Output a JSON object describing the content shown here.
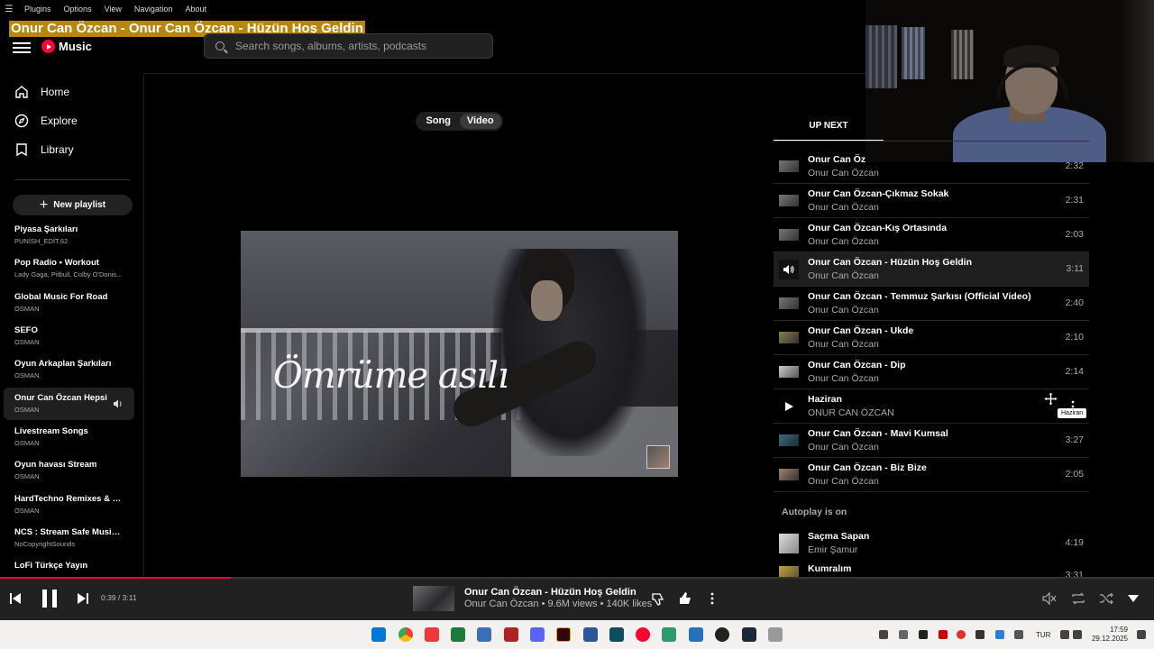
{
  "menu": {
    "items": [
      "Plugins",
      "Options",
      "View",
      "Navigation",
      "About"
    ]
  },
  "window_title": "Onur Can Özcan - Onur Can Özcan - Hüzün Hoş Geldin",
  "header": {
    "logo_text": "Music",
    "search_placeholder": "Search songs, albums, artists, podcasts"
  },
  "sidebar": {
    "nav": [
      {
        "label": "Home",
        "icon": "home-icon"
      },
      {
        "label": "Explore",
        "icon": "compass-icon"
      },
      {
        "label": "Library",
        "icon": "library-icon"
      }
    ],
    "new_playlist": "New playlist",
    "playlists": [
      {
        "title": "Piyasa Şarkıları",
        "sub": "PUNİSH_EDİT.62"
      },
      {
        "title": "Pop Radio • Workout",
        "sub": "Lady Gaga, Pitbull, Colby O'Donis..."
      },
      {
        "title": "Global Music For Road",
        "sub": "OSMAN"
      },
      {
        "title": "SEFO",
        "sub": "OSMAN"
      },
      {
        "title": "Oyun Arkaplan Şarkıları",
        "sub": "OSMAN"
      },
      {
        "title": "Onur Can Özcan Hepsi",
        "sub": "OSMAN"
      },
      {
        "title": "Livestream Songs",
        "sub": "OSMAN"
      },
      {
        "title": "Oyun havası Stream",
        "sub": "OSMAN"
      },
      {
        "title": "HardTechno Remixes & Bo...",
        "sub": "OSMAN"
      },
      {
        "title": "NCS : Stream Safe Music fo...",
        "sub": "NoCopyrightSounds"
      },
      {
        "title": "LoFi Türkçe Yayın",
        "sub": ""
      }
    ]
  },
  "toggle": {
    "song": "Song",
    "video": "Video",
    "selected": "Video"
  },
  "video": {
    "overlay_text": "Ömrüme asılı"
  },
  "right_panel": {
    "tab_upnext": "UP NEXT",
    "queue": [
      {
        "title": "Onur Can Öz",
        "artist": "Onur Can Özcan",
        "duration": "2:32"
      },
      {
        "title": "Onur Can Özcan-Çıkmaz Sokak",
        "artist": "Onur Can Özcan",
        "duration": "2:31"
      },
      {
        "title": "Onur Can Özcan-Kış Ortasında",
        "artist": "Onur Can Özcan",
        "duration": "2:03"
      },
      {
        "title": "Onur Can Özcan - Hüzün Hoş Geldin",
        "artist": "Onur Can Özcan",
        "duration": "3:11"
      },
      {
        "title": "Onur Can Özcan - Temmuz Şarkısı (Official Video)",
        "artist": "Onur Can Özcan",
        "duration": "2:40"
      },
      {
        "title": "Onur Can Özcan - Ukde",
        "artist": "Onur Can Özcan",
        "duration": "2:10"
      },
      {
        "title": "Onur Can Özcan - Dip",
        "artist": "Onur Can Özcan",
        "duration": "2:14"
      },
      {
        "title": "Haziran",
        "artist": "ONUR CAN ÖZCAN",
        "duration": ""
      },
      {
        "title": "Onur Can Özcan - Mavi Kumsal",
        "artist": "Onur Can Özcan",
        "duration": "3:27"
      },
      {
        "title": "Onur Can Özcan - Biz Bize",
        "artist": "Onur Can Özcan",
        "duration": "2:05"
      }
    ],
    "autoplay_label": "Autoplay is on",
    "autoplay": [
      {
        "title": "Saçma Sapan",
        "artist": "Emir Şamur",
        "duration": "4:19"
      },
      {
        "title": "Kumralım",
        "artist": "",
        "duration": "3:31"
      }
    ],
    "tooltip": "Haziran"
  },
  "player": {
    "time": "0:39 / 3:11",
    "progress": 0.2,
    "title": "Onur Can Özcan - Hüzün Hoş Geldin",
    "subtitle": "Onur Can Özcan • 9.6M views • 140K likes"
  },
  "taskbar": {
    "lang": "TUR",
    "time": "17:59",
    "date": "29.12.2025"
  },
  "colors": {
    "accent": "#ff0033",
    "title_highlight": "#b8860b"
  }
}
